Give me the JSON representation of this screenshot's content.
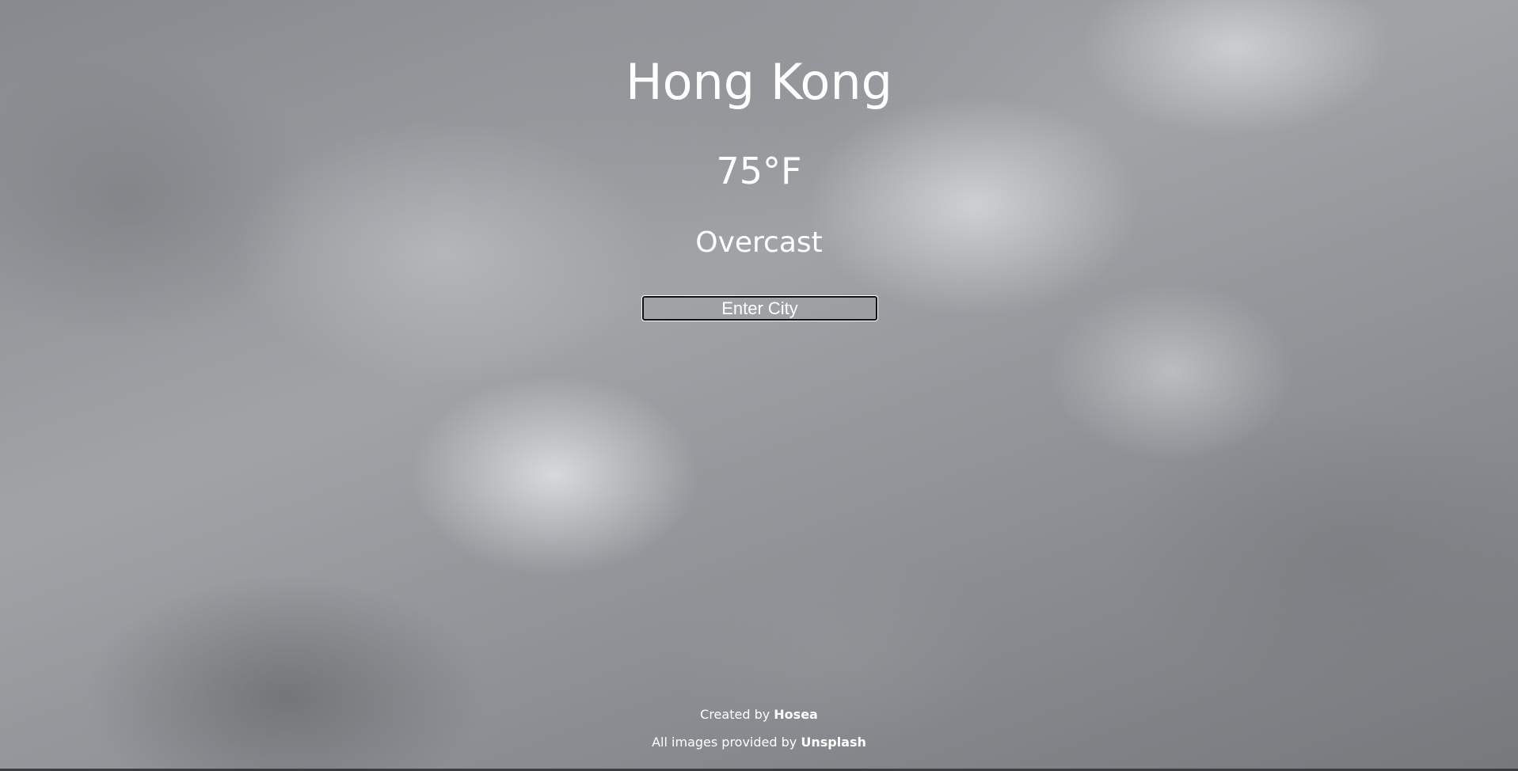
{
  "weather": {
    "city": "Hong Kong",
    "temperature": "75°F",
    "condition": "Overcast"
  },
  "search": {
    "placeholder": "Enter City"
  },
  "footer": {
    "created_prefix": "Created by ",
    "author": "Hosea",
    "images_prefix": "All images provided by ",
    "image_source": "Unsplash"
  },
  "colors": {
    "text": "#ffffff",
    "input_border": "#111111"
  },
  "background": {
    "description_icon": "overcast-cloud-background"
  }
}
